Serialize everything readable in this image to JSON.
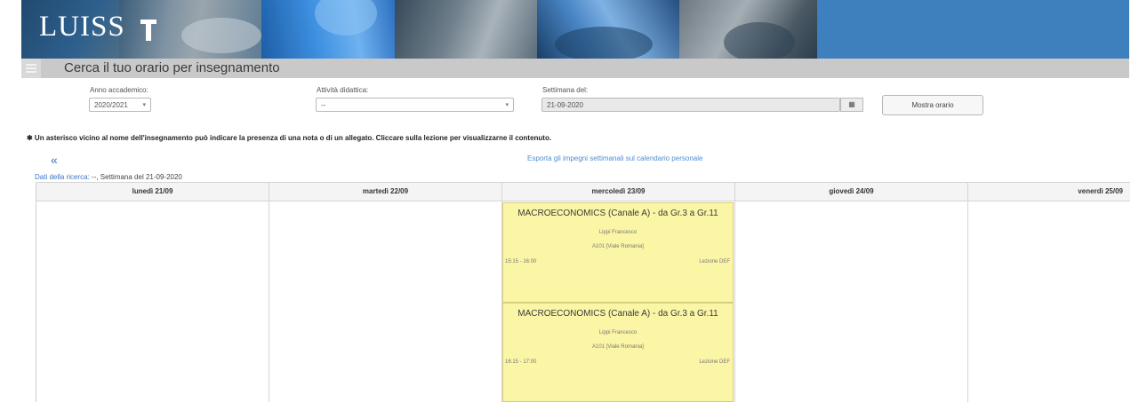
{
  "header": {
    "logo_text": "LUISS",
    "page_title": "Cerca il tuo orario per insegnamento"
  },
  "form": {
    "academic_year": {
      "label": "Anno accademico:",
      "value": "2020/2021"
    },
    "activity": {
      "label": "Attività didattica:",
      "value": "--"
    },
    "week": {
      "label": "Settimana del:",
      "value": "21-09-2020"
    },
    "show_button": "Mostra orario"
  },
  "note": "✱ Un asterisco vicino al nome dell'insegnamento può indicare la presenza di una nota o di un allegato. Cliccare sulla lezione per visualizzarne il contenuto.",
  "nav": {
    "prev": "«",
    "export_link": "Esporta gli impegni settimanali sul calendario personale"
  },
  "search_info": {
    "link": "Dati della ricerca:",
    "text": " --, Settimana del 21-09-2020"
  },
  "calendar": {
    "days": [
      "lunedì 21/09",
      "martedì 22/09",
      "mercoledì 23/09",
      "giovedì 24/09",
      "venerdì 25/09"
    ],
    "lessons": [
      {
        "title": "MACROECONOMICS (Canale A) - da Gr.3 a Gr.11",
        "teacher": "Lippi Francesco",
        "room": "A101 [Viale Romania]",
        "time": "15:15 - 16:00",
        "type": "Lezione DEF"
      },
      {
        "title": "MACROECONOMICS (Canale A) - da Gr.3 a Gr.11",
        "teacher": "Lippi Francesco",
        "room": "A101 [Viale Romania]",
        "time": "16:15 - 17:00",
        "type": "Lezione DEF"
      }
    ]
  },
  "colors": {
    "header_blue": "#3e7fbd",
    "title_bar": "#c9c9c9",
    "lesson_bg": "#fbf6a6",
    "link": "#4f8ed1"
  }
}
